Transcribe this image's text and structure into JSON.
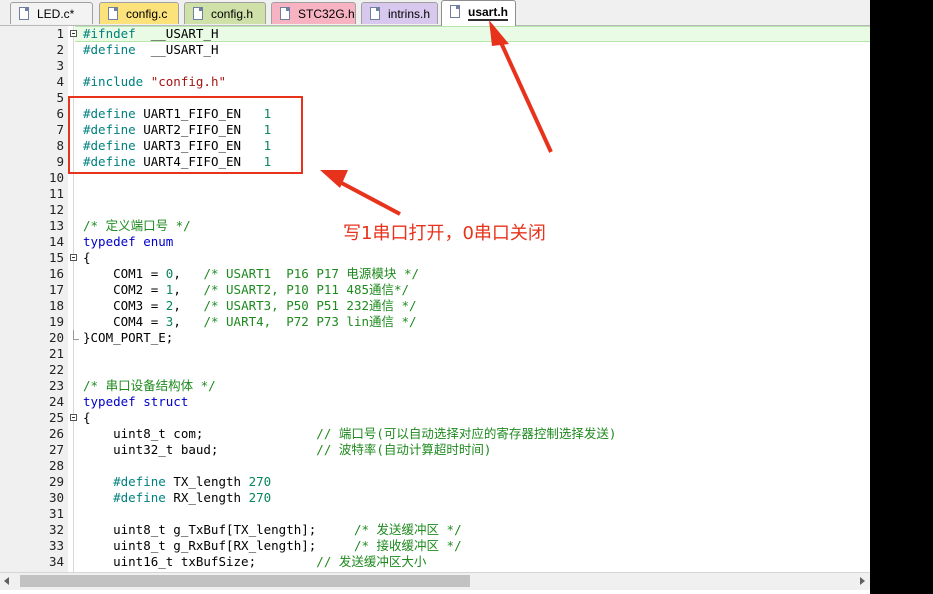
{
  "tabs": [
    {
      "label": "LED.c*",
      "color": "#f3f3f3"
    },
    {
      "label": "config.c",
      "color": "#fbe27a"
    },
    {
      "label": "config.h",
      "color": "#cfe0a8"
    },
    {
      "label": "STC32G.h",
      "color": "#f7b3c2"
    },
    {
      "label": "intrins.h",
      "color": "#d8c8ee"
    },
    {
      "label": "usart.h",
      "color": "#ffffff",
      "active": true
    }
  ],
  "lines": [
    {
      "n": "1",
      "fold": "box",
      "t": [
        [
          "pp",
          "#ifndef"
        ],
        [
          "",
          "  __USART_H"
        ]
      ]
    },
    {
      "n": "2",
      "t": [
        [
          "pp",
          "#define"
        ],
        [
          "",
          "  __USART_H"
        ]
      ]
    },
    {
      "n": "3",
      "t": []
    },
    {
      "n": "4",
      "t": [
        [
          "pp",
          "#include "
        ],
        [
          "str",
          "\"config.h\""
        ]
      ]
    },
    {
      "n": "5",
      "t": []
    },
    {
      "n": "6",
      "t": [
        [
          "pp",
          "#define"
        ],
        [
          "",
          " UART1_FIFO_EN   "
        ],
        [
          "num",
          "1"
        ]
      ]
    },
    {
      "n": "7",
      "t": [
        [
          "pp",
          "#define"
        ],
        [
          "",
          " UART2_FIFO_EN   "
        ],
        [
          "num",
          "1"
        ]
      ]
    },
    {
      "n": "8",
      "t": [
        [
          "pp",
          "#define"
        ],
        [
          "",
          " UART3_FIFO_EN   "
        ],
        [
          "num",
          "1"
        ]
      ]
    },
    {
      "n": "9",
      "t": [
        [
          "pp",
          "#define"
        ],
        [
          "",
          " UART4_FIFO_EN   "
        ],
        [
          "num",
          "1"
        ]
      ]
    },
    {
      "n": "10",
      "t": []
    },
    {
      "n": "11",
      "t": []
    },
    {
      "n": "12",
      "t": []
    },
    {
      "n": "13",
      "t": [
        [
          "cm",
          "/* 定义端口号 */"
        ]
      ]
    },
    {
      "n": "14",
      "t": [
        [
          "kw",
          "typedef enum"
        ]
      ]
    },
    {
      "n": "15",
      "fold": "box",
      "t": [
        [
          "",
          "{"
        ]
      ]
    },
    {
      "n": "16",
      "t": [
        [
          "",
          "    COM1 = "
        ],
        [
          "num",
          "0"
        ],
        [
          "",
          ",   "
        ],
        [
          "cm",
          "/* USART1  P16 P17 电源模块 */"
        ]
      ]
    },
    {
      "n": "17",
      "t": [
        [
          "",
          "    COM2 = "
        ],
        [
          "num",
          "1"
        ],
        [
          "",
          ",   "
        ],
        [
          "cm",
          "/* USART2, P10 P11 485通信*/"
        ]
      ]
    },
    {
      "n": "18",
      "t": [
        [
          "",
          "    COM3 = "
        ],
        [
          "num",
          "2"
        ],
        [
          "",
          ",   "
        ],
        [
          "cm",
          "/* USART3, P50 P51 232通信 */"
        ]
      ]
    },
    {
      "n": "19",
      "t": [
        [
          "",
          "    COM4 = "
        ],
        [
          "num",
          "3"
        ],
        [
          "",
          ",   "
        ],
        [
          "cm",
          "/* UART4,  P72 P73 lin通信 */"
        ]
      ]
    },
    {
      "n": "20",
      "fold": "end",
      "t": [
        [
          "",
          "}COM_PORT_E;"
        ]
      ]
    },
    {
      "n": "21",
      "t": []
    },
    {
      "n": "22",
      "t": []
    },
    {
      "n": "23",
      "t": [
        [
          "cm",
          "/* 串口设备结构体 */"
        ]
      ]
    },
    {
      "n": "24",
      "t": [
        [
          "kw",
          "typedef struct"
        ]
      ]
    },
    {
      "n": "25",
      "fold": "box",
      "t": [
        [
          "",
          "{"
        ]
      ]
    },
    {
      "n": "26",
      "t": [
        [
          "",
          "    uint8_t com;               "
        ],
        [
          "cm",
          "// 端口号(可以自动选择对应的寄存器控制选择发送)"
        ]
      ]
    },
    {
      "n": "27",
      "t": [
        [
          "",
          "    uint32_t baud;             "
        ],
        [
          "cm",
          "// 波特率(自动计算超时时间)"
        ]
      ]
    },
    {
      "n": "28",
      "t": []
    },
    {
      "n": "29",
      "t": [
        [
          "pp",
          "    #define"
        ],
        [
          "",
          " TX_length "
        ],
        [
          "num",
          "270"
        ]
      ]
    },
    {
      "n": "30",
      "t": [
        [
          "pp",
          "    #define"
        ],
        [
          "",
          " RX_length "
        ],
        [
          "num",
          "270"
        ]
      ]
    },
    {
      "n": "31",
      "t": []
    },
    {
      "n": "32",
      "t": [
        [
          "",
          "    uint8_t g_TxBuf[TX_length];     "
        ],
        [
          "cm",
          "/* 发送缓冲区 */"
        ]
      ]
    },
    {
      "n": "33",
      "t": [
        [
          "",
          "    uint8_t g_RxBuf[RX_length];     "
        ],
        [
          "cm",
          "/* 接收缓冲区 */"
        ]
      ]
    },
    {
      "n": "34",
      "t": [
        [
          "",
          "    uint16_t txBufSize;        "
        ],
        [
          "cm",
          "// 发送缓冲区大小"
        ]
      ]
    }
  ],
  "annotation": {
    "text": "写1串口打开，0串口关闭",
    "color": "#e8331c"
  },
  "scrollbar": {
    "position_fraction": 0
  }
}
